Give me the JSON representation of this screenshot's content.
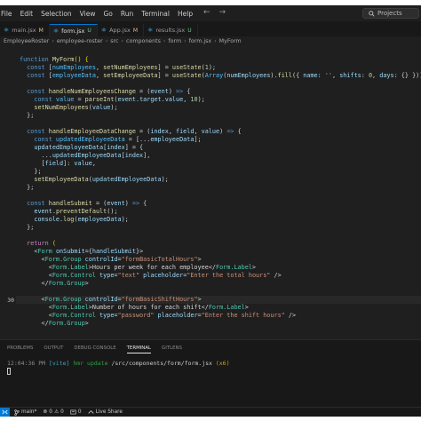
{
  "menu": {
    "items": [
      "File",
      "Edit",
      "Selection",
      "View",
      "Go",
      "Run",
      "Terminal",
      "Help"
    ],
    "back_glyph": "←",
    "forward_glyph": "→",
    "search_label": "Projects"
  },
  "tabs": [
    {
      "label": "main.jsx",
      "badge": "M",
      "icon": "react-icon",
      "active": false
    },
    {
      "label": "form.jsx",
      "badge": "U",
      "icon": "react-icon",
      "active": true
    },
    {
      "label": "App.jsx",
      "badge": "M",
      "icon": "react-icon",
      "active": false
    },
    {
      "label": "results.jsx",
      "badge": "U",
      "icon": "react-icon",
      "active": false
    }
  ],
  "breadcrumb": [
    "EmployeeRoster",
    "employee-roster",
    "src",
    "components",
    "form",
    "form.jsx",
    "MyForm"
  ],
  "editor": {
    "line_numbers": [
      "",
      "",
      "",
      "",
      "",
      "",
      "",
      "",
      "",
      "",
      "",
      "",
      "",
      "",
      "",
      "",
      "",
      "",
      "",
      "",
      "",
      "",
      "",
      "",
      "",
      "",
      "",
      "",
      "",
      "",
      "",
      "30",
      "",
      "",
      "",
      "",
      "",
      "",
      "",
      "",
      "",
      "",
      "",
      ""
    ],
    "lines": [
      [
        [
          "",
          ""
        ]
      ],
      [
        [
          "kw",
          "function "
        ],
        [
          "fn",
          "MyForm"
        ],
        [
          "br",
          "() {"
        ]
      ],
      [
        [
          "kw",
          "  const "
        ],
        [
          "p",
          "["
        ],
        [
          "const",
          "numEmployees"
        ],
        [
          "p",
          ", "
        ],
        [
          "fn",
          "setNumEmployees"
        ],
        [
          "p",
          "] = "
        ],
        [
          "fn",
          "useState"
        ],
        [
          "p",
          "("
        ],
        [
          "num",
          "1"
        ],
        [
          "p",
          ");"
        ]
      ],
      [
        [
          "kw",
          "  const "
        ],
        [
          "p",
          "["
        ],
        [
          "const",
          "employeeData"
        ],
        [
          "p",
          ", "
        ],
        [
          "fn",
          "setEmployeeData"
        ],
        [
          "p",
          "] = "
        ],
        [
          "fn",
          "useState"
        ],
        [
          "p",
          "("
        ],
        [
          "const",
          "Array"
        ],
        [
          "p",
          "("
        ],
        [
          "var",
          "numEmployees"
        ],
        [
          "p",
          ")."
        ],
        [
          "fn",
          "fill"
        ],
        [
          "p",
          "({ "
        ],
        [
          "var",
          "name"
        ],
        [
          "p",
          ": "
        ],
        [
          "str",
          "''"
        ],
        [
          "p",
          ", "
        ],
        [
          "var",
          "shifts"
        ],
        [
          "p",
          ": "
        ],
        [
          "num",
          "0"
        ],
        [
          "p",
          ", "
        ],
        [
          "var",
          "days"
        ],
        [
          "p",
          ": {} }));"
        ]
      ],
      [
        [
          "",
          ""
        ]
      ],
      [
        [
          "kw",
          "  const "
        ],
        [
          "fn",
          "handleNumEmployeesChange"
        ],
        [
          "p",
          " = ("
        ],
        [
          "var",
          "event"
        ],
        [
          "p",
          ") "
        ],
        [
          "kw",
          "=> "
        ],
        [
          "p",
          "{"
        ]
      ],
      [
        [
          "kw",
          "    const "
        ],
        [
          "const",
          "value"
        ],
        [
          "p",
          " = "
        ],
        [
          "fn",
          "parseInt"
        ],
        [
          "p",
          "("
        ],
        [
          "var",
          "event"
        ],
        [
          "p",
          "."
        ],
        [
          "var",
          "target"
        ],
        [
          "p",
          "."
        ],
        [
          "var",
          "value"
        ],
        [
          "p",
          ", "
        ],
        [
          "num",
          "10"
        ],
        [
          "p",
          ");"
        ]
      ],
      [
        [
          "fn",
          "    setNumEmployees"
        ],
        [
          "p",
          "("
        ],
        [
          "var",
          "value"
        ],
        [
          "p",
          ");"
        ]
      ],
      [
        [
          "p",
          "  };"
        ]
      ],
      [
        [
          "",
          ""
        ]
      ],
      [
        [
          "kw",
          "  const "
        ],
        [
          "fn",
          "handleEmployeeDataChange"
        ],
        [
          "p",
          " = ("
        ],
        [
          "var",
          "index"
        ],
        [
          "p",
          ", "
        ],
        [
          "var",
          "field"
        ],
        [
          "p",
          ", "
        ],
        [
          "var",
          "value"
        ],
        [
          "p",
          ") "
        ],
        [
          "kw",
          "=> "
        ],
        [
          "p",
          "{"
        ]
      ],
      [
        [
          "kw",
          "    const "
        ],
        [
          "const",
          "updatedEmployeeData"
        ],
        [
          "p",
          " = [..."
        ],
        [
          "var",
          "employeeData"
        ],
        [
          "p",
          "];"
        ]
      ],
      [
        [
          "var",
          "    updatedEmployeeData"
        ],
        [
          "p",
          "["
        ],
        [
          "var",
          "index"
        ],
        [
          "p",
          "] = {"
        ]
      ],
      [
        [
          "p",
          "      ..."
        ],
        [
          "var",
          "updatedEmployeeData"
        ],
        [
          "p",
          "["
        ],
        [
          "var",
          "index"
        ],
        [
          "p",
          "],"
        ]
      ],
      [
        [
          "p",
          "      ["
        ],
        [
          "var",
          "field"
        ],
        [
          "p",
          "]: "
        ],
        [
          "var",
          "value"
        ],
        [
          "p",
          ","
        ]
      ],
      [
        [
          "p",
          "    };"
        ]
      ],
      [
        [
          "fn",
          "    setEmployeeData"
        ],
        [
          "p",
          "("
        ],
        [
          "var",
          "updatedEmployeeData"
        ],
        [
          "p",
          ");"
        ]
      ],
      [
        [
          "p",
          "  };"
        ]
      ],
      [
        [
          "",
          ""
        ]
      ],
      [
        [
          "kw",
          "  const "
        ],
        [
          "fn",
          "handleSubmit"
        ],
        [
          "p",
          " = ("
        ],
        [
          "var",
          "event"
        ],
        [
          "p",
          ") "
        ],
        [
          "kw",
          "=> "
        ],
        [
          "p",
          "{"
        ]
      ],
      [
        [
          "var",
          "    event"
        ],
        [
          "p",
          "."
        ],
        [
          "fn",
          "preventDefault"
        ],
        [
          "p",
          "();"
        ]
      ],
      [
        [
          "var",
          "    console"
        ],
        [
          "p",
          "."
        ],
        [
          "fn",
          "log"
        ],
        [
          "p",
          "("
        ],
        [
          "var",
          "employeeData"
        ],
        [
          "p",
          ");"
        ]
      ],
      [
        [
          "p",
          "  };"
        ]
      ],
      [
        [
          "",
          ""
        ]
      ],
      [
        [
          "ctl",
          "  return "
        ],
        [
          "br",
          "("
        ]
      ],
      [
        [
          "p",
          "    <"
        ],
        [
          "tag",
          "Form "
        ],
        [
          "attr",
          "onSubmit"
        ],
        [
          "p",
          "={"
        ],
        [
          "var",
          "handleSubmit"
        ],
        [
          "p",
          "}>"
        ]
      ],
      [
        [
          "p",
          "      <"
        ],
        [
          "tag",
          "Form.Group "
        ],
        [
          "attr",
          "controlId"
        ],
        [
          "p",
          "="
        ],
        [
          "str",
          "\"formBasicTotalHours\""
        ],
        [
          "p",
          ">"
        ]
      ],
      [
        [
          "p",
          "        <"
        ],
        [
          "tag",
          "Form.Label"
        ],
        [
          "p",
          ">"
        ],
        [
          "text",
          "Hours per week for each employee"
        ],
        [
          "p",
          "</"
        ],
        [
          "tag",
          "Form.Label"
        ],
        [
          "p",
          ">"
        ]
      ],
      [
        [
          "p",
          "        <"
        ],
        [
          "tag",
          "Form.Control "
        ],
        [
          "attr",
          "type"
        ],
        [
          "p",
          "="
        ],
        [
          "str",
          "\"text\" "
        ],
        [
          "attr",
          "placeholder"
        ],
        [
          "p",
          "="
        ],
        [
          "str",
          "\"Enter the total hours\" "
        ],
        [
          "p",
          "/>"
        ]
      ],
      [
        [
          "p",
          "      </"
        ],
        [
          "tag",
          "Form.Group"
        ],
        [
          "p",
          ">"
        ]
      ],
      [
        [
          "",
          ""
        ]
      ],
      [
        [
          "p",
          "      <"
        ],
        [
          "tag",
          "Form.Group "
        ],
        [
          "attr",
          "controlId"
        ],
        [
          "p",
          "="
        ],
        [
          "str",
          "\"formBasicShiftHours\""
        ],
        [
          "p",
          ">"
        ]
      ],
      [
        [
          "p",
          "        <"
        ],
        [
          "tag",
          "Form.Label"
        ],
        [
          "p",
          ">"
        ],
        [
          "text",
          "Number of hours for each shift"
        ],
        [
          "p",
          "</"
        ],
        [
          "tag",
          "Form.Label"
        ],
        [
          "p",
          ">"
        ]
      ],
      [
        [
          "p",
          "        <"
        ],
        [
          "tag",
          "Form.Control "
        ],
        [
          "attr",
          "type"
        ],
        [
          "p",
          "="
        ],
        [
          "str",
          "\"password\" "
        ],
        [
          "attr",
          "placeholder"
        ],
        [
          "p",
          "="
        ],
        [
          "str",
          "\"Enter the shift hours\" "
        ],
        [
          "p",
          "/>"
        ]
      ],
      [
        [
          "p",
          "      </"
        ],
        [
          "tag",
          "Form.Group"
        ],
        [
          "p",
          ">"
        ]
      ]
    ]
  },
  "panel": {
    "tabs": [
      "PROBLEMS",
      "OUTPUT",
      "DEBUG CONSOLE",
      "TERMINAL",
      "GITLENS"
    ],
    "active_tab": "TERMINAL",
    "terminal": {
      "time": "12:04:36 PM",
      "tag": "[vite]",
      "hmr": "hmr update",
      "path": "/src/components/form/form.jsx",
      "count": "(x6)"
    }
  },
  "status": {
    "branch": "main*",
    "errors": "0",
    "warnings": "0",
    "errors_glyph": "⊗",
    "warnings_glyph": "⚠",
    "ports": "0",
    "live_share": "Live Share"
  },
  "colors": {
    "accent": "#0078d4",
    "editor_bg": "#1f1f1f",
    "panel_bg": "#181818"
  }
}
